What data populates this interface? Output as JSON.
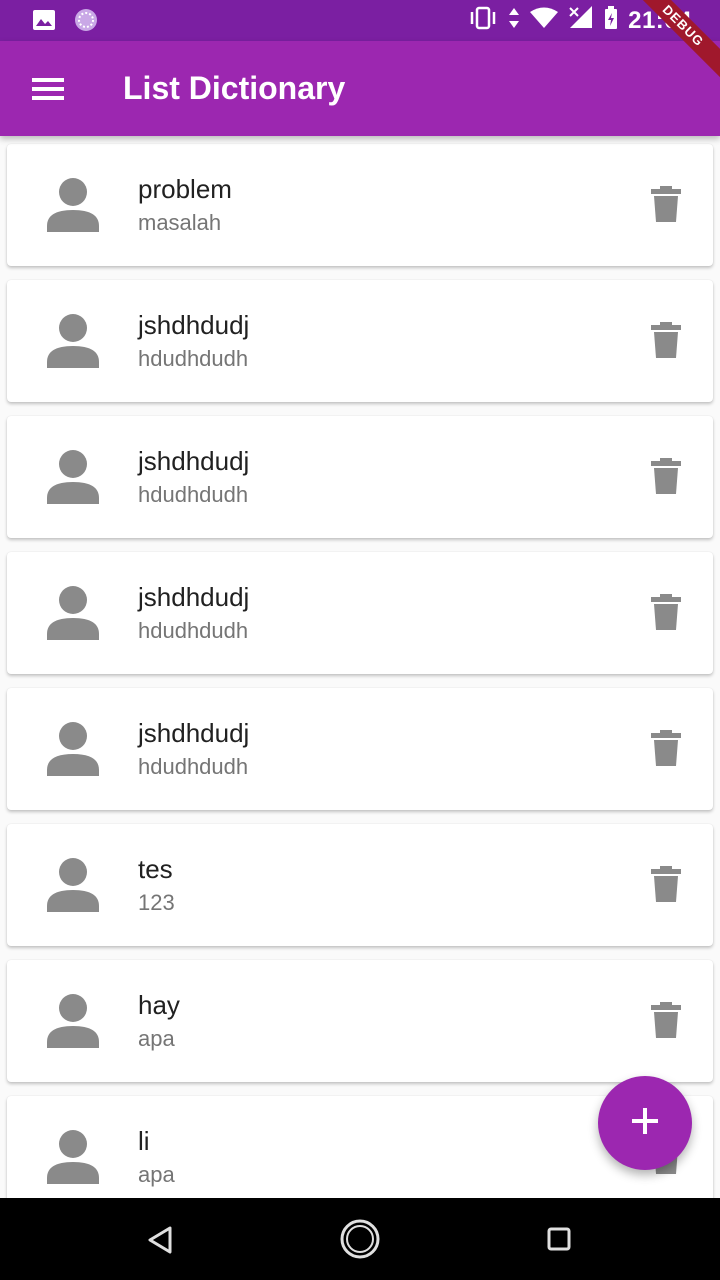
{
  "status_bar": {
    "time": "21:04",
    "icons": [
      "image-icon",
      "app-icon",
      "vibrate-icon",
      "data-arrows-icon",
      "wifi-icon",
      "signal-icon",
      "battery-icon"
    ]
  },
  "debug_banner": "DEBUG",
  "app_bar": {
    "title": "List Dictionary",
    "menu_icon": "menu-icon"
  },
  "items": [
    {
      "word": "problem",
      "meaning": "masalah"
    },
    {
      "word": "jshdhdudj",
      "meaning": "hdudhdudh"
    },
    {
      "word": "jshdhdudj",
      "meaning": "hdudhdudh"
    },
    {
      "word": "jshdhdudj",
      "meaning": "hdudhdudh"
    },
    {
      "word": "jshdhdudj",
      "meaning": "hdudhdudh"
    },
    {
      "word": "tes",
      "meaning": "123"
    },
    {
      "word": "hay",
      "meaning": "apa"
    },
    {
      "word": "li",
      "meaning": "apa"
    }
  ],
  "fab": {
    "icon": "plus-icon"
  },
  "nav_bar": {
    "icons": [
      "back-icon",
      "home-icon",
      "recent-apps-icon"
    ]
  },
  "colors": {
    "primary": "#9c27b0",
    "primary_dark": "#7b1fa2",
    "icon_grey": "#8a8a8a",
    "debug": "#a0182c"
  }
}
